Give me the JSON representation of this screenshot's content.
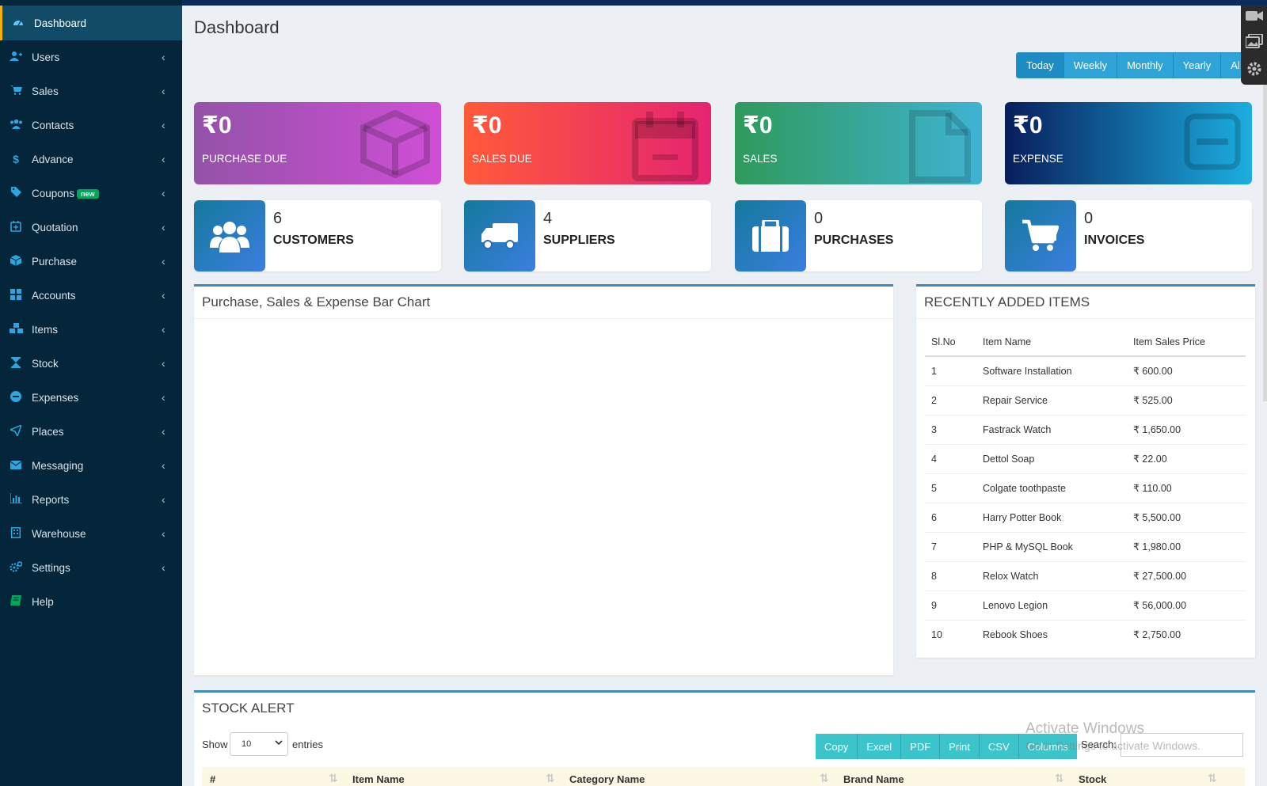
{
  "sidebar": {
    "items": [
      {
        "label": "Dashboard",
        "icon": "dashboard-icon",
        "active": true,
        "chevron": false
      },
      {
        "label": "Users",
        "icon": "user-plus-icon",
        "chevron": true
      },
      {
        "label": "Sales",
        "icon": "cart-icon",
        "chevron": true
      },
      {
        "label": "Contacts",
        "icon": "users-icon",
        "chevron": true
      },
      {
        "label": "Advance",
        "icon": "dollar-icon",
        "chevron": true
      },
      {
        "label": "Coupons",
        "icon": "tag-icon",
        "chevron": true,
        "badge": "new"
      },
      {
        "label": "Quotation",
        "icon": "calendar-plus-icon",
        "chevron": true
      },
      {
        "label": "Purchase",
        "icon": "cube-icon",
        "chevron": true
      },
      {
        "label": "Accounts",
        "icon": "grid-icon",
        "chevron": true
      },
      {
        "label": "Items",
        "icon": "cubes-icon",
        "chevron": true
      },
      {
        "label": "Stock",
        "icon": "hourglass-icon",
        "chevron": true
      },
      {
        "label": "Expenses",
        "icon": "minus-circle-icon",
        "chevron": true
      },
      {
        "label": "Places",
        "icon": "paper-plane-icon",
        "chevron": true
      },
      {
        "label": "Messaging",
        "icon": "envelope-icon",
        "chevron": true
      },
      {
        "label": "Reports",
        "icon": "bar-chart-icon",
        "chevron": true
      },
      {
        "label": "Warehouse",
        "icon": "building-icon",
        "chevron": true
      },
      {
        "label": "Settings",
        "icon": "cogs-icon",
        "chevron": true
      },
      {
        "label": "Help",
        "icon": "book-icon",
        "chevron": false
      }
    ]
  },
  "header": {
    "title": "Dashboard",
    "period_buttons": [
      "Today",
      "Weekly",
      "Monthly",
      "Yearly",
      "Al"
    ],
    "active_period": "Today"
  },
  "summary_cards": [
    {
      "amount": "₹0",
      "label": "PURCHASE DUE",
      "icon": "cube-icon"
    },
    {
      "amount": "₹0",
      "label": "SALES DUE",
      "icon": "calendar-icon"
    },
    {
      "amount": "₹0",
      "label": "SALES",
      "icon": "file-icon"
    },
    {
      "amount": "₹0",
      "label": "EXPENSE",
      "icon": "minus-square-icon"
    }
  ],
  "info_boxes": [
    {
      "count": "6",
      "label": "CUSTOMERS",
      "icon": "users-icon"
    },
    {
      "count": "4",
      "label": "SUPPLIERS",
      "icon": "truck-icon"
    },
    {
      "count": "0",
      "label": "PURCHASES",
      "icon": "briefcase-icon"
    },
    {
      "count": "0",
      "label": "INVOICES",
      "icon": "cart-icon"
    }
  ],
  "chart_panel": {
    "title": "Purchase, Sales & Expense Bar Chart"
  },
  "recent_items": {
    "title": "RECENTLY ADDED ITEMS",
    "columns": [
      "Sl.No",
      "Item Name",
      "Item Sales Price"
    ],
    "rows": [
      [
        "1",
        "Software Installation",
        "₹ 600.00"
      ],
      [
        "2",
        "Repair Service",
        "₹ 525.00"
      ],
      [
        "3",
        "Fastrack Watch",
        "₹ 1,650.00"
      ],
      [
        "4",
        "Dettol Soap",
        "₹ 22.00"
      ],
      [
        "5",
        "Colgate toothpaste",
        "₹ 110.00"
      ],
      [
        "6",
        "Harry Potter Book",
        "₹ 5,500.00"
      ],
      [
        "7",
        "PHP & MySQL Book",
        "₹ 1,980.00"
      ],
      [
        "8",
        "Relox Watch",
        "₹ 27,500.00"
      ],
      [
        "9",
        "Lenovo Legion",
        "₹ 56,000.00"
      ],
      [
        "10",
        "Rebook Shoes",
        "₹ 2,750.00"
      ]
    ]
  },
  "stock_alert": {
    "title": "STOCK ALERT",
    "show_label": "Show",
    "entries_value": "10",
    "entries_label": "entries",
    "buttons": [
      "Copy",
      "Excel",
      "PDF",
      "Print",
      "CSV",
      "Columns"
    ],
    "search_label": "Search:",
    "columns": [
      "#",
      "Item Name",
      "Category Name",
      "Brand Name",
      "Stock"
    ]
  },
  "watermark": {
    "line1": "Activate Windows",
    "line2": "Go to Settings to activate Windows."
  },
  "colors": {
    "sidebar_bg": "#04253a",
    "accent": "#3c8dbc",
    "period_btn": "#2fa4d8",
    "dt_btn": "#3bc4c9"
  }
}
